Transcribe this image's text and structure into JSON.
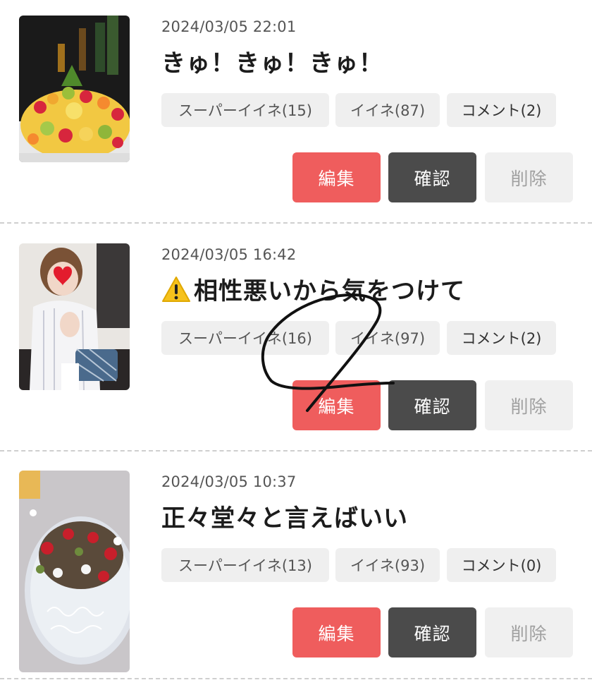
{
  "posts": [
    {
      "timestamp": "2024/03/05 22:01",
      "title": "きゅ！きゅ！きゅ！",
      "has_warning_icon": false,
      "thumbnail": "fruit-platter-photo",
      "stats": {
        "super_like": "スーパーイイネ(15)",
        "like": "イイネ(87)",
        "comment": "コメント(2)"
      },
      "buttons": {
        "edit": "編集",
        "confirm": "確認",
        "delete": "削除"
      }
    },
    {
      "timestamp": "2024/03/05 16:42",
      "title": "相性悪いから気をつけて",
      "has_warning_icon": true,
      "warning_icon": "warning-icon",
      "thumbnail": "woman-photo-heart-sticker",
      "stats": {
        "super_like": "スーパーイイネ(16)",
        "like": "イイネ(97)",
        "comment": "コメント(2)"
      },
      "buttons": {
        "edit": "編集",
        "confirm": "確認",
        "delete": "削除"
      }
    },
    {
      "timestamp": "2024/03/05 10:37",
      "title": "正々堂々と言えばいい",
      "has_warning_icon": false,
      "thumbnail": "dessert-plate-photo",
      "stats": {
        "super_like": "スーパーイイネ(13)",
        "like": "イイネ(93)",
        "comment": "コメント(0)"
      },
      "buttons": {
        "edit": "編集",
        "confirm": "確認",
        "delete": "削除"
      }
    }
  ],
  "colors": {
    "edit_button": "#ef5d5d",
    "confirm_button": "#4b4b4b",
    "delete_button": "#f0f0f0",
    "stat_pill": "#efefef",
    "scribble": "#111111"
  },
  "annotation": "hand-drawn-scribble-mark"
}
